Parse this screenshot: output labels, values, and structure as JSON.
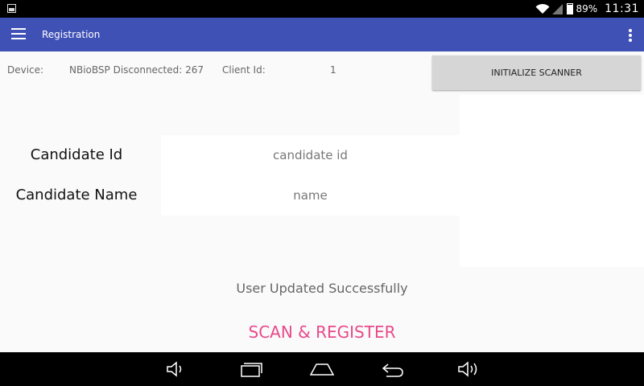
{
  "status_bar": {
    "battery_text": "89%",
    "battery_level": 0.89,
    "time": "11:31"
  },
  "app_bar": {
    "title": "Registration",
    "menu_icon": "hamburger-menu-icon",
    "overflow_icon": "more-vertical-icon",
    "color": "#3f51b5"
  },
  "info": {
    "device_label": "Device:",
    "device_value": "NBioBSP Disconnected: 267",
    "client_label": "Client Id:",
    "client_value": "1"
  },
  "initialize_button": {
    "label": "INITIALIZE SCANNER"
  },
  "form": {
    "candidate_id": {
      "label": "Candidate Id",
      "placeholder": "candidate id",
      "value": ""
    },
    "candidate_name": {
      "label": "Candidate Name",
      "placeholder": "name",
      "value": ""
    }
  },
  "status_message": "User Updated Successfully",
  "scan_button": {
    "label": "SCAN & REGISTER",
    "color": "#e84a8a"
  },
  "nav_bar": {
    "icons": [
      "volume-down-icon",
      "recent-apps-icon",
      "home-icon",
      "back-icon",
      "volume-up-icon"
    ]
  }
}
